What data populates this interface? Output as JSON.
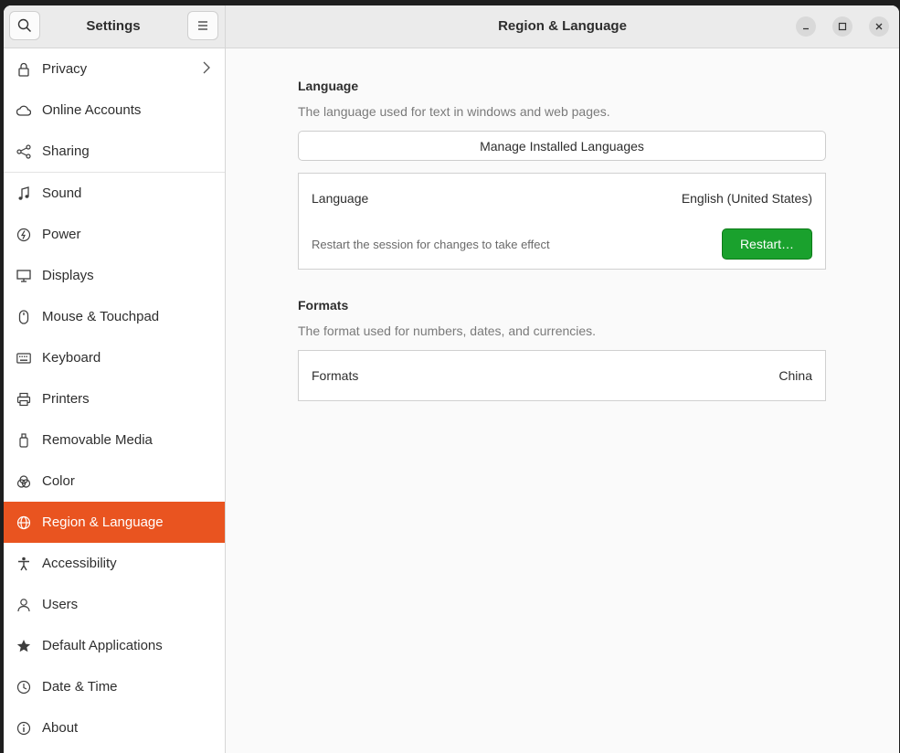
{
  "sidebar": {
    "title": "Settings",
    "items": [
      {
        "label": "Privacy"
      },
      {
        "label": "Online Accounts"
      },
      {
        "label": "Sharing"
      },
      {
        "label": "Sound"
      },
      {
        "label": "Power"
      },
      {
        "label": "Displays"
      },
      {
        "label": "Mouse & Touchpad"
      },
      {
        "label": "Keyboard"
      },
      {
        "label": "Printers"
      },
      {
        "label": "Removable Media"
      },
      {
        "label": "Color"
      },
      {
        "label": "Region & Language"
      },
      {
        "label": "Accessibility"
      },
      {
        "label": "Users"
      },
      {
        "label": "Default Applications"
      },
      {
        "label": "Date & Time"
      },
      {
        "label": "About"
      }
    ],
    "active_item": "Region & Language"
  },
  "header": {
    "title": "Region & Language"
  },
  "language_section": {
    "title": "Language",
    "description": "The language used for text in windows and web pages.",
    "manage_button": "Manage Installed Languages",
    "row_label": "Language",
    "row_value": "English (United States)",
    "restart_note": "Restart the session for changes to take effect",
    "restart_button": "Restart…"
  },
  "formats_section": {
    "title": "Formats",
    "description": "The format used for numbers, dates, and currencies.",
    "row_label": "Formats",
    "row_value": "China"
  },
  "colors": {
    "accent": "#e95420",
    "restart_green": "#1aa12d"
  }
}
